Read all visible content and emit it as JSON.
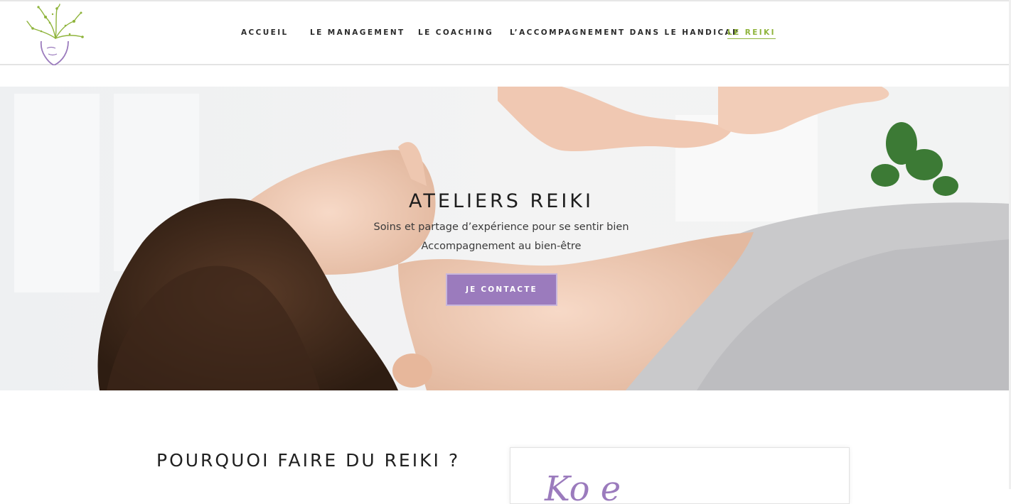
{
  "nav": {
    "items": [
      {
        "label": "ACCUEIL",
        "active": false
      },
      {
        "label": "LE MANAGEMENT",
        "active": false
      },
      {
        "label": "LE COACHING",
        "active": false
      },
      {
        "label": "L’ACCOMPAGNEMENT DANS LE HANDICAP",
        "active": false
      },
      {
        "label": "LE REIKI",
        "active": true
      }
    ],
    "active_color": "#8fb43c"
  },
  "logo": {
    "icon": "tree-face-logo",
    "colors": [
      "#8fb43c",
      "#9b7bbd"
    ]
  },
  "hero": {
    "title": "ATELIERS REIKI",
    "subtitle_line1": "Soins et partage d’expérience pour se sentir bien",
    "subtitle_line2": "Accompagnement au bien-être",
    "cta_label": "JE CONTACTE",
    "cta_color": "#9b7bbd"
  },
  "section": {
    "title": "POURQUOI FAIRE DU REIKI ?",
    "card_script": "Ko e"
  }
}
